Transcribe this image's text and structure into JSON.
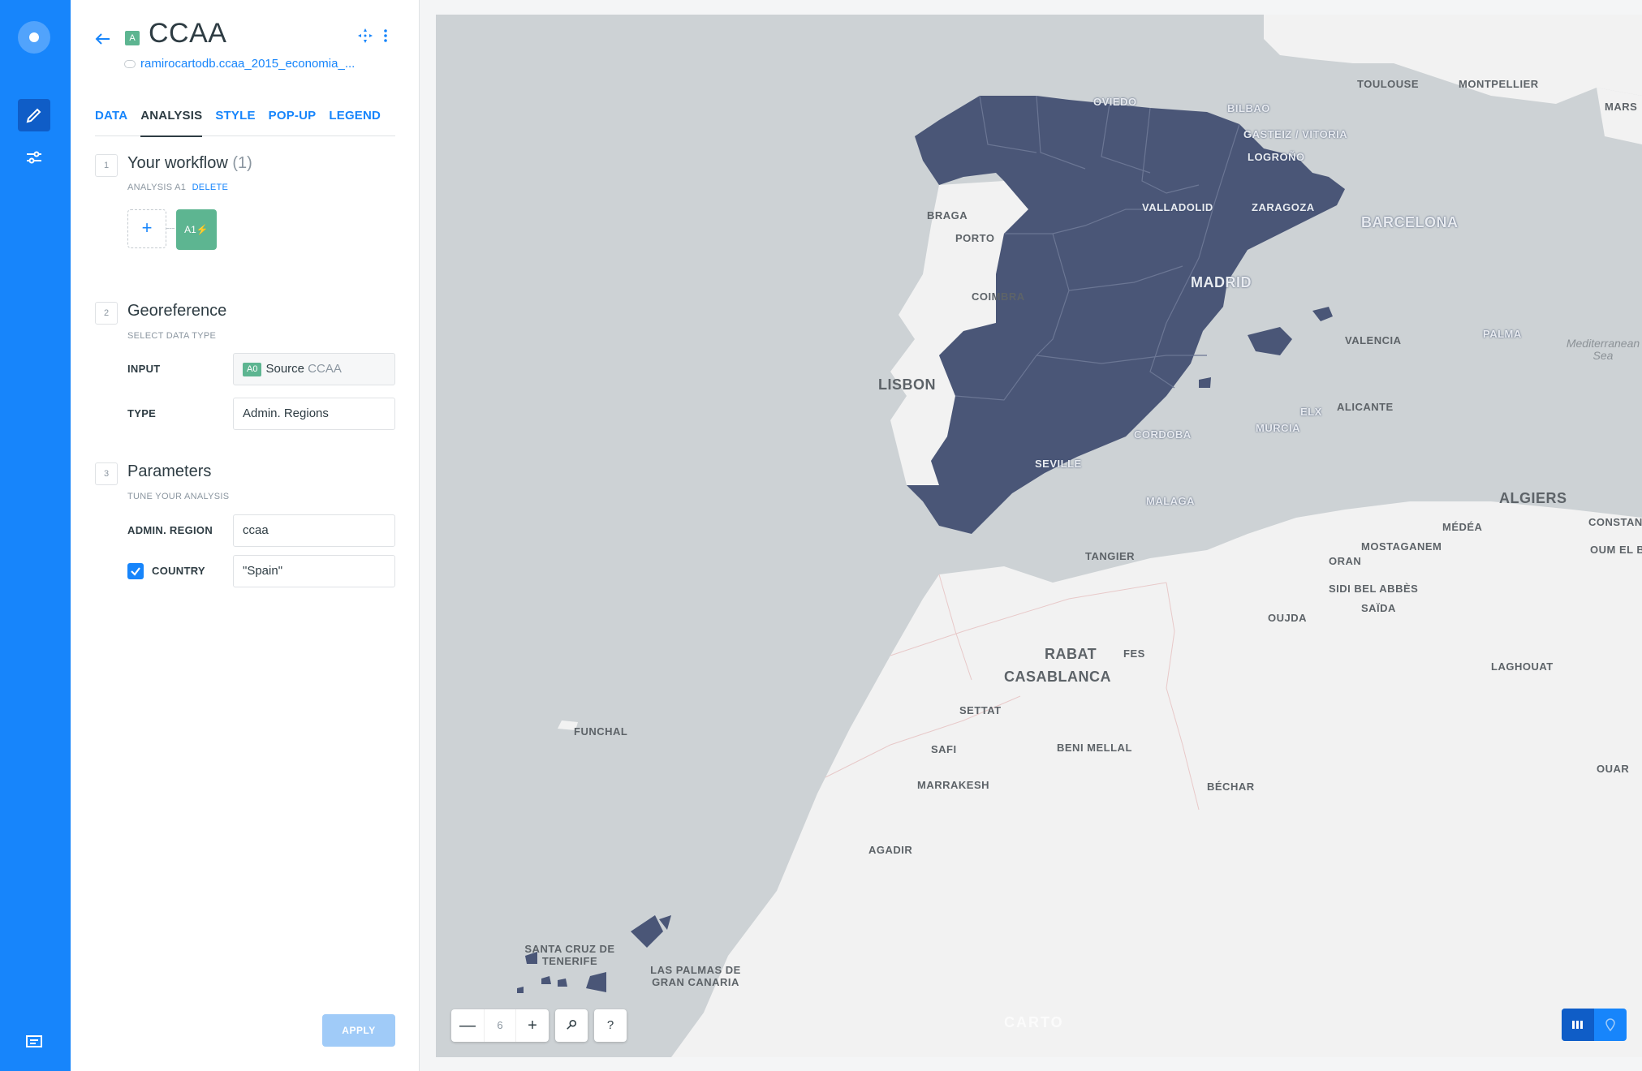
{
  "layer": {
    "badge": "A",
    "title": "CCAA",
    "source": "ramirocartodb.ccaa_2015_economia_..."
  },
  "tabs": [
    "DATA",
    "ANALYSIS",
    "STYLE",
    "POP-UP",
    "LEGEND"
  ],
  "active_tab": "ANALYSIS",
  "workflow": {
    "step": "1",
    "title": "Your workflow",
    "count": "(1)",
    "analysis_label": "ANALYSIS A1",
    "delete_label": "DELETE",
    "add_symbol": "+",
    "node_label": "A1"
  },
  "georeference": {
    "step": "2",
    "title": "Georeference",
    "subtitle": "SELECT DATA TYPE",
    "input_label": "INPUT",
    "input_badge": "A0",
    "input_value": "Source",
    "input_source": "CCAA",
    "type_label": "TYPE",
    "type_value": "Admin. Regions"
  },
  "parameters": {
    "step": "3",
    "title": "Parameters",
    "subtitle": "TUNE YOUR ANALYSIS",
    "admin_label": "ADMIN. REGION",
    "admin_value": "ccaa",
    "country_label": "COUNTRY",
    "country_checked": true,
    "country_value": "\"Spain\""
  },
  "apply_label": "APPLY",
  "map": {
    "zoom_level": "6",
    "zoom_out": "—",
    "zoom_in": "+",
    "help": "?",
    "attribution": "CARTO",
    "region_fill": "#4a5677",
    "cities": [
      {
        "name": "TOULOUSE"
      },
      {
        "name": "MONTPELLIER"
      },
      {
        "name": "MARS"
      },
      {
        "name": "OVIEDO"
      },
      {
        "name": "BILBAO"
      },
      {
        "name": "GASTEIZ / VITORIA"
      },
      {
        "name": "LOGROÑO"
      },
      {
        "name": "BRAGA"
      },
      {
        "name": "PORTO"
      },
      {
        "name": "VALLADOLID"
      },
      {
        "name": "ZARAGOZA"
      },
      {
        "name": "BARCELONA"
      },
      {
        "name": "MADRID"
      },
      {
        "name": "COIMBRA"
      },
      {
        "name": "VALENCIA"
      },
      {
        "name": "PALMA"
      },
      {
        "name": "LISBON"
      },
      {
        "name": "ALICANTE"
      },
      {
        "name": "ELX"
      },
      {
        "name": "MURCIA"
      },
      {
        "name": "CORDOBA"
      },
      {
        "name": "SEVILLE"
      },
      {
        "name": "MALAGA"
      },
      {
        "name": "ALGIERS"
      },
      {
        "name": "CONSTANT"
      },
      {
        "name": "MÉDÉA"
      },
      {
        "name": "OUM EL BO"
      },
      {
        "name": "TANGIER"
      },
      {
        "name": "MOSTAGANEM"
      },
      {
        "name": "ORAN"
      },
      {
        "name": "SIDI BEL ABBÈS"
      },
      {
        "name": "SAÏDA"
      },
      {
        "name": "OUJDA"
      },
      {
        "name": "RABAT"
      },
      {
        "name": "FES"
      },
      {
        "name": "CASABLANCA"
      },
      {
        "name": "LAGHOUAT"
      },
      {
        "name": "SETTAT"
      },
      {
        "name": "SAFI"
      },
      {
        "name": "BENI MELLAL"
      },
      {
        "name": "MARRAKESH"
      },
      {
        "name": "BÉCHAR"
      },
      {
        "name": "OUAR"
      },
      {
        "name": "AGADIR"
      },
      {
        "name": "FUNCHAL"
      },
      {
        "name": "SANTA CRUZ DE TENERIFE"
      },
      {
        "name": "LAS PALMAS DE GRAN CANARIA"
      }
    ],
    "sea_label": "Mediterranean Sea"
  }
}
